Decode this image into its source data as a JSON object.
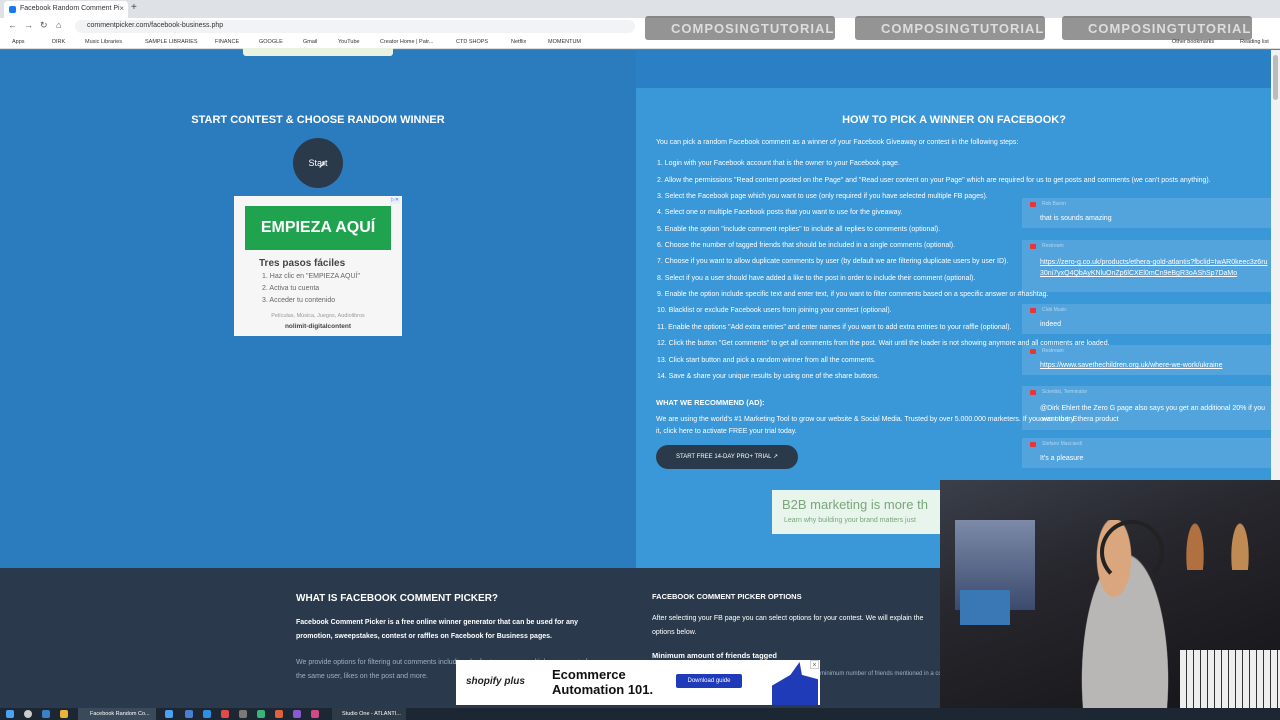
{
  "browser": {
    "tab_title": "Facebook Random Comment Pi",
    "url": "commentpicker.com/facebook-business.php",
    "bookmarks": [
      "Apps",
      "DIRK",
      "Music Libraries",
      "SAMPLE LIBRARIES",
      "FINANCE",
      "GOOGLE",
      "Gmail",
      "YouTube",
      "Creator Home | Patr...",
      "CTD SHOPS",
      "Netflix",
      "MOMENTUM",
      "Other bookmarks",
      "Reading list"
    ]
  },
  "watermark": "COMPOSINGTUTORIALS",
  "left": {
    "title": "START CONTEST & CHOOSE RANDOM WINNER",
    "start_label": "Start"
  },
  "ad": {
    "cta": "EMPIEZA AQUÍ",
    "heading": "Tres pasos fáciles",
    "steps": [
      "1. Haz clic en \"EMPIEZA AQUÍ\"",
      "2. Activa tu cuenta",
      "3. Acceder tu contenido"
    ],
    "footer": "Películas, Música, Juegos, Audiolibros",
    "brand": "nolimit-digitalcontent"
  },
  "right": {
    "title": "HOW TO PICK A WINNER ON FACEBOOK?",
    "intro": "You can pick a random Facebook comment as a winner of your Facebook Giveaway or contest in the following steps:",
    "steps": [
      "1. Login with your Facebook account that is the owner to your Facebook page.",
      "2. Allow the permissions \"Read content posted on the Page\" and \"Read user content on your Page\" which are required for us to get posts and comments (we can't posts anything).",
      "3. Select the Facebook page which you want to use (only required if you have selected multiple FB pages).",
      "4. Select one or multiple Facebook posts that you want to use for the giveaway.",
      "5. Enable the option \"include comment replies\" to include all replies to comments (optional).",
      "6. Choose the number of tagged friends that should be included in a single comments (optional).",
      "7. Choose if you want to allow duplicate comments by user (by default we are filtering duplicate users by user ID).",
      "8. Select if you a user should have added a like to the post in order to include their comment (optional).",
      "9. Enable the option include specific text and enter text, if you want to filter comments based on a specific answer or #hashtag.",
      "10. Blacklist or exclude Facebook users from joining your contest (optional).",
      "11. Enable the options \"Add extra entries\" and enter names if you want to add extra entries to your raffle (optional).",
      "12. Click the button \"Get comments\" to get all comments from the post. Wait until the loader is not showing anymore and all comments are loaded.",
      "13. Click start button and pick a random winner from all the comments.",
      "14. Save & share your unique results by using one of the share buttons."
    ],
    "recommend_title": "WHAT WE RECOMMEND (AD):",
    "recommend_text": "We are using the world's #1 Marketing Tool to grow our website & Social Media. Trusted by over 5.000.000 marketers. If you want to try it, click here to activate FREE your trial today.",
    "trial_label": "START FREE 14-DAY PRO+ TRIAL"
  },
  "b2b_ad": {
    "heading": "B2B marketing is more th",
    "sub": "Learn why building your brand matters just"
  },
  "chat": [
    {
      "user": "Rob Baron",
      "text": "that is sounds amazing",
      "link": false
    },
    {
      "user": "Restream",
      "text": "https://zero-g.co.uk/products/ethera-gold-atlantis?fbclid=IwAR0keec3z6ru30ni7yxQ4QbAyKNluOnZp6lCXEl0mCn9eBgR3oAShSp7DaMo",
      "link": true
    },
    {
      "user": "Clob Music",
      "text": "indeed",
      "link": false
    },
    {
      "user": "Restream",
      "text": "https://www.savethechildren.org.uk/where-we-work/ukraine",
      "link": true
    },
    {
      "user": "Scientist, Terminator",
      "text": "@Dirk Ehlert the Zero G page also says you get an additional 20% if you own other Ethera product",
      "link": false
    },
    {
      "user": "Stefano Macciardi",
      "text": "It's a pleasure",
      "link": false
    }
  ],
  "bottom": {
    "what_title": "WHAT IS FACEBOOK COMMENT PICKER?",
    "what_text": "Facebook Comment Picker is a free online winner generator that can be used for any promotion, sweepstakes, contest or raffles on Facebook for Business pages.",
    "what_text2": "We provide options for filtering out comments including duplicate users or multiple comments from the same user, likes on the post and more.",
    "options_title": "FACEBOOK COMMENT PICKER OPTIONS",
    "options_text": "After selecting your FB page you can select options for your contest. We will explain the options below.",
    "options_sub": "Minimum amount of friends tagged",
    "options_aside": "minimum number of friends mentioned in a comment. friends mentioned. By default it is set"
  },
  "shopify_ad": {
    "logo": "shopify plus",
    "heading": "Ecommerce Automation 101.",
    "button": "Download guide"
  },
  "taskbar": {
    "firefox_label": "Facebook Random Co...",
    "studio_label": "Studio One - ATLANTI..."
  },
  "colors": {
    "page_blue": "#2e8fd0",
    "dark_navy": "#2a3a4c",
    "ad_green": "#1fa34f",
    "shopify_blue": "#1f3bb8"
  }
}
